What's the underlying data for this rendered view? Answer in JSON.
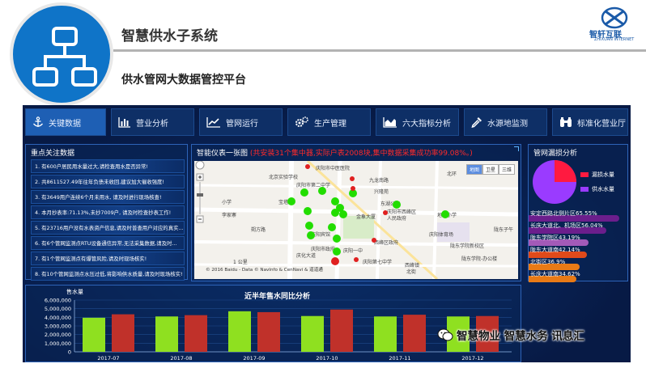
{
  "header": {
    "title": "智慧供水子系统",
    "subtitle": "供水管网大数据管控平台",
    "brand_name": "智轩互联",
    "brand_en": "ZHIXUAN INTERNET"
  },
  "nav": [
    {
      "label": "关键数据",
      "icon": "anchor-icon"
    },
    {
      "label": "营业分析",
      "icon": "bar-chart-icon"
    },
    {
      "label": "管网运行",
      "icon": "line-chart-icon"
    },
    {
      "label": "生产管理",
      "icon": "gears-icon"
    },
    {
      "label": "六大指标分析",
      "icon": "area-chart-icon"
    },
    {
      "label": "水源地监测",
      "icon": "dropper-icon"
    },
    {
      "label": "标准化营业厅",
      "icon": "binoculars-icon"
    }
  ],
  "key_data": {
    "title": "重点关注数据",
    "items": [
      "1. 有600户居民用水量过大,请检查用水是否异常!",
      "2. 共8611527.49年往年负债未收回,建议加大催收强度!",
      "3. 有3649用户连续6个月未用水, 请及时进行现场核查!",
      "4. 本月抄表率:71.13%,未抄7009户, 请及时检查抄表工作!",
      "5. 有23716用户没有水表资产信息,请及时普查用户对应的真实...",
      "6. 有6个管网监测点RTU设备通信异常,无法采集数据,请及时...",
      "7. 有1个管网监测点有爆管风险,请及时现场核实!",
      "8. 有10个管网监测点水压过低,将影响供水质量,请及时现场核实!"
    ]
  },
  "map_panel": {
    "title": "智能仪表一张图",
    "alert": "(共安装31个集中器,实际户表2008块,集中数据采集成功率99.08%。)",
    "map_types": [
      "地图",
      "卫星",
      "三维"
    ],
    "labels": {
      "l1": "庆阳市中医医院",
      "l2": "北京实验学校",
      "l3": "庆阳市第二中学",
      "l4": "九龙南路",
      "l5": "兴隆苑",
      "l6": "北环",
      "l7": "东湖公园",
      "l8": "庆阳市西峰区",
      "l9": "人民政府",
      "l10": "金象大厦",
      "l11": "地区小学",
      "l12": "宝塔",
      "l13": "朔方路",
      "l14": "李家寨",
      "l15": "庆阳宾馆",
      "l16": "庆阳体育场",
      "l17": "庆阳市政府",
      "l18": "西峰区政府",
      "l19": "庆阳一中",
      "l20": "陇东学院新校区",
      "l21": "陇东学院-办公楼",
      "l22": "庆阳第七中学",
      "l23": "北街",
      "l24": "西峰镇",
      "l25": "庆化大道",
      "l26": "小学",
      "l27": "陇东子午"
    },
    "scale": "1 公里",
    "copyright": "© 2016 Baidu - Data © NavInfo & CenNavi & 道道通"
  },
  "leak_panel": {
    "title": "管网漏损分析",
    "legend": [
      {
        "label": "漏损水量",
        "color": "#ff1a40"
      },
      {
        "label": "供水水量",
        "color": "#9a3bff"
      }
    ],
    "districts": [
      {
        "label": "安定西路北侧片区65.55%",
        "value": 65.55,
        "color": "#6b1e8c"
      },
      {
        "label": "长庆大道北、机场区56.04%",
        "value": 56.04,
        "color": "#6b1e8c"
      },
      {
        "label": "陇东学院区43.19%",
        "value": 43.19,
        "color": "#a35ab8"
      },
      {
        "label": "陇东大道南42.14%",
        "value": 42.14,
        "color": "#e04a1a"
      },
      {
        "label": "北街区36.9%",
        "value": 36.9,
        "color": "#e87a16"
      },
      {
        "label": "长庆大道南34.62%",
        "value": 34.62,
        "color": "#e87a16"
      }
    ]
  },
  "chart_data": {
    "type": "bar",
    "title": "近半年售水同比分析",
    "ylabel": "售水量",
    "categories": [
      "2017-07",
      "2017-08",
      "2017-09",
      "2017-10",
      "2017-11",
      "2017-12"
    ],
    "series": [
      {
        "color": "#8fe020",
        "values": [
          3950000,
          4100000,
          4700000,
          4150000,
          4100000,
          4100000
        ]
      },
      {
        "color": "#c0312a",
        "values": [
          4350000,
          4250000,
          4600000,
          4900000,
          4300000,
          4150000
        ]
      }
    ],
    "ylim": [
      0,
      6000000
    ],
    "yticks": [
      "6,000,000",
      "5,000,000",
      "4,000,000",
      "3,000,000",
      "2,000,000",
      "1,000,000",
      "0"
    ]
  },
  "watermark": "智慧物业 智慧水务 讯息汇"
}
